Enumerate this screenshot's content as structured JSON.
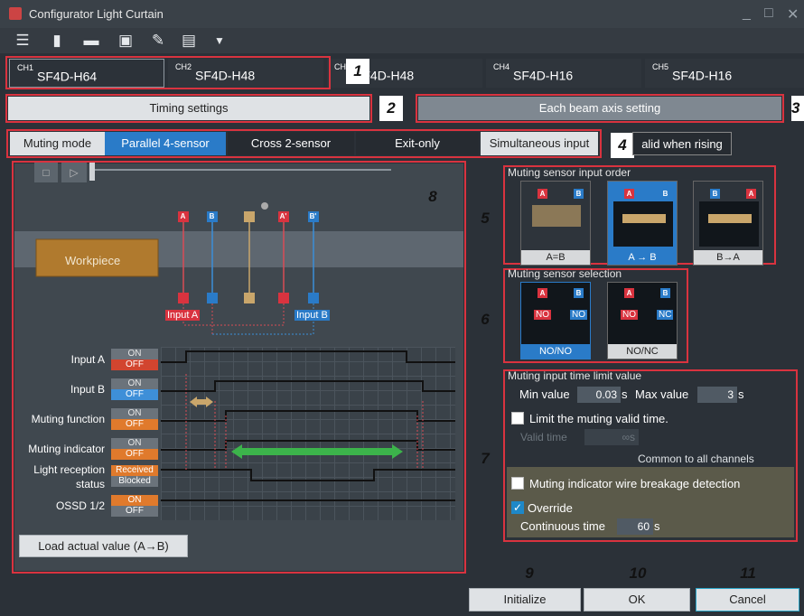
{
  "title": "Configurator Light Curtain",
  "window_controls": {
    "minimize": "_",
    "maximize": "□",
    "close": "✕"
  },
  "toolbar": {
    "icons": [
      "menu-icon",
      "new-file-icon",
      "open-folder-icon",
      "save-icon",
      "edit-icon",
      "info-icon",
      "dropdown-icon"
    ]
  },
  "channels": [
    {
      "ch": "CH1",
      "model": "SF4D-H64"
    },
    {
      "ch": "CH2",
      "model": "SF4D-H48"
    },
    {
      "ch": "CH3",
      "model": "SF4D-H48"
    },
    {
      "ch": "CH4",
      "model": "SF4D-H16"
    },
    {
      "ch": "CH5",
      "model": "SF4D-H16"
    }
  ],
  "settings_tabs": {
    "timing": "Timing settings",
    "beam": "Each beam axis setting"
  },
  "muting_mode": {
    "label": "Muting mode",
    "options": [
      "Parallel 4-sensor",
      "Cross 2-sensor",
      "Exit-only",
      "Simultaneous input"
    ],
    "selected": "Parallel 4-sensor",
    "valid_when_rising": "Valid when rising",
    "valid_when_rising_visible": "alid when rising"
  },
  "callouts": [
    "1",
    "2",
    "3",
    "4",
    "5",
    "6",
    "7",
    "8",
    "9",
    "10",
    "11"
  ],
  "simulation": {
    "workpiece": "Workpiece",
    "sensors": [
      "A",
      "B",
      "A'",
      "B'"
    ],
    "input_a": "Input A",
    "input_b": "Input B",
    "rows": [
      {
        "label": "Input A",
        "on": "ON",
        "off": "OFF"
      },
      {
        "label": "Input B",
        "on": "ON",
        "off": "OFF"
      },
      {
        "label": "Muting function",
        "on": "ON",
        "off": "OFF"
      },
      {
        "label": "Muting indicator",
        "on": "ON",
        "off": "OFF"
      },
      {
        "label_line1": "Light reception",
        "label_line2": "status",
        "on": "Received",
        "off": "Blocked"
      },
      {
        "label": "OSSD 1/2",
        "on": "ON",
        "off": "OFF"
      }
    ],
    "load_button": "Load actual value (A→B)"
  },
  "input_order": {
    "title": "Muting sensor input order",
    "options": [
      "A=B",
      "A → B",
      "B→A"
    ],
    "selected": "A → B"
  },
  "sensor_selection": {
    "title": "Muting sensor selection",
    "options": [
      {
        "caption": "NO/NO",
        "a": "NO",
        "b": "NO"
      },
      {
        "caption": "NO/NC",
        "a": "NO",
        "b": "NC"
      }
    ],
    "selected": "NO/NO"
  },
  "time_limit": {
    "title": "Muting input time limit value",
    "min_label": "Min value",
    "min_value": "0.03",
    "min_unit": "s",
    "max_label": "Max value",
    "max_value": "3",
    "max_unit": "s",
    "limit_valid_time": "Limit the muting valid time.",
    "valid_time_label": "Valid time",
    "valid_time_value": "∞s",
    "common": "Common to all channels",
    "wire_breakage": "Muting indicator wire breakage detection",
    "override": "Override",
    "continuous_time_label": "Continuous time",
    "continuous_time_value": "60",
    "continuous_time_unit": "s"
  },
  "footer": {
    "initialize": "Initialize",
    "ok": "OK",
    "cancel": "Cancel"
  },
  "colors": {
    "accent_blue": "#2a7bc8",
    "red": "#d9333f",
    "green": "#3cb44b",
    "gold": "#c9a66b"
  }
}
